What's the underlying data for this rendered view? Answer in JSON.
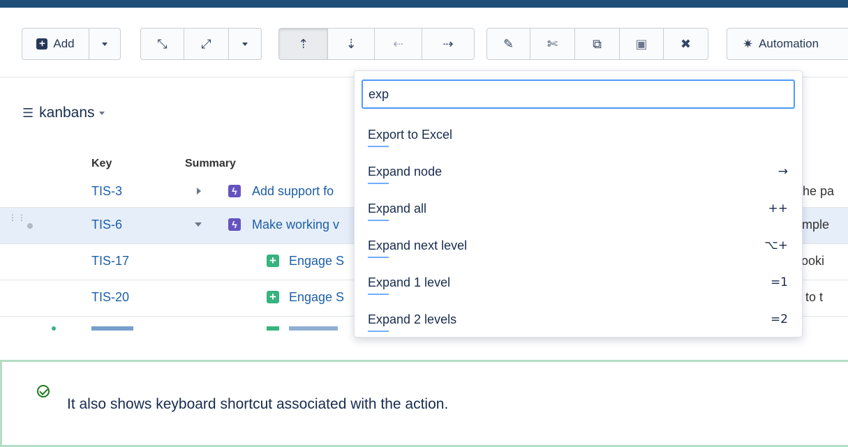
{
  "toolbar": {
    "add_label": "Add",
    "automation_label": "Automation",
    "icons": [
      "plus-square-icon",
      "expand-icon",
      "collapse-icon",
      "move-up-icon",
      "move-down-icon",
      "outdent-icon",
      "indent-icon",
      "pencil-icon",
      "scissors-icon",
      "copy-icon",
      "paste-icon",
      "close-icon",
      "magic-wand-icon"
    ]
  },
  "project": {
    "name": "kanbans"
  },
  "table": {
    "headers": {
      "key": "Key",
      "summary": "Summary"
    },
    "rows": [
      {
        "key": "TIS-3",
        "summary": "Add support fo",
        "right": "n the pa"
      },
      {
        "key": "TIS-6",
        "summary": "Make working v",
        "right": "xample"
      },
      {
        "key": "TIS-17",
        "summary": "Engage S",
        "right": "s looki"
      },
      {
        "key": "TIS-20",
        "summary": "Engage S",
        "right": "ay to t"
      }
    ]
  },
  "menu": {
    "search_value": "exp",
    "items": [
      {
        "label": "Export to Excel",
        "shortcut": ""
      },
      {
        "label": "Expand node",
        "shortcut": "→"
      },
      {
        "label": "Expand all",
        "shortcut": "++"
      },
      {
        "label": "Expand next level",
        "shortcut": "⌥+"
      },
      {
        "label": "Expand 1 level",
        "shortcut": "=1"
      },
      {
        "label": "Expand 2 levels",
        "shortcut": "=2"
      }
    ]
  },
  "note": {
    "text": "It also shows keyboard shortcut associated with the action."
  },
  "colors": {
    "accent": "#4c9aff",
    "link": "#1d5fa8",
    "epic": "#6554c0",
    "story": "#36b37e",
    "note_border": "#b5dcc5"
  }
}
